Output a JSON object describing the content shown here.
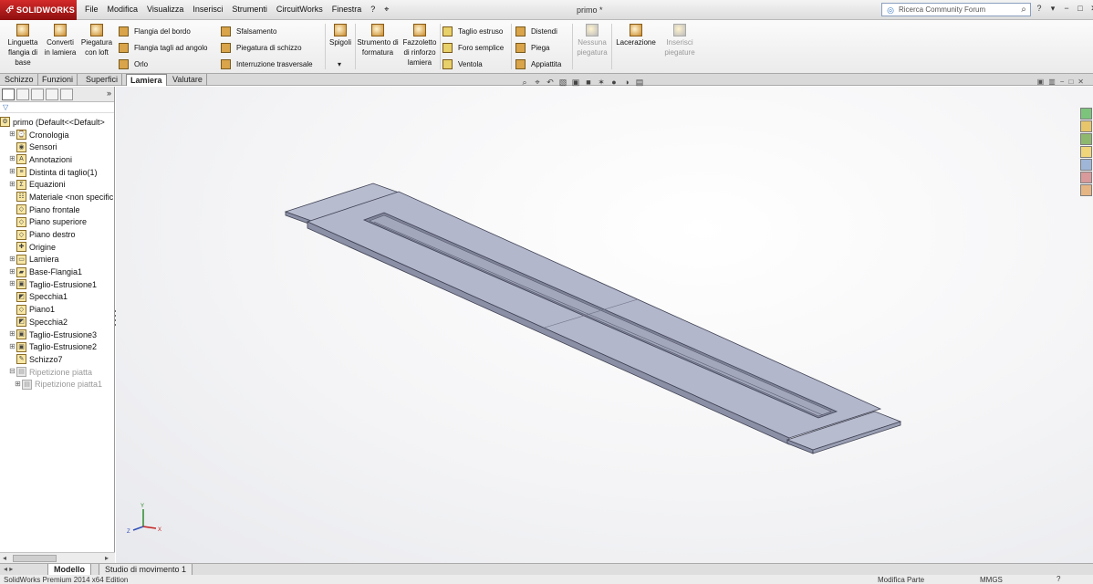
{
  "app": {
    "logo_text": "SOLIDWORKS",
    "document_title": "primo *"
  },
  "menu": [
    "File",
    "Modifica",
    "Visualizza",
    "Inserisci",
    "Strumenti",
    "CircuitWorks",
    "Finestra",
    "?"
  ],
  "search": {
    "placeholder": "Ricerca Community Forum"
  },
  "ribbon": {
    "big_buttons": [
      {
        "label": "Linguetta flangia di base",
        "icon": "base-flange-icon",
        "enabled": true
      },
      {
        "label": "Converti in lamiera",
        "icon": "convert-sheetmetal-icon",
        "enabled": true
      },
      {
        "label": "Piegatura con loft",
        "icon": "lofted-bend-icon",
        "enabled": true
      },
      {
        "label": "Spigoli",
        "icon": "corners-icon",
        "enabled": true
      },
      {
        "label": "Strumento di formatura",
        "icon": "forming-tool-icon",
        "enabled": true
      },
      {
        "label": "Fazzoletto di rinforzo lamiera",
        "icon": "gusset-icon",
        "enabled": true
      },
      {
        "label": "Nessuna piegatura",
        "icon": "no-bends-icon",
        "enabled": false
      },
      {
        "label": "Lacerazione",
        "icon": "rip-icon",
        "enabled": true
      },
      {
        "label": "Inserisci piegature",
        "icon": "insert-bends-icon",
        "enabled": false
      }
    ],
    "col1": [
      "Flangia del bordo",
      "Flangia tagli ad angolo",
      "Orlo"
    ],
    "col2": [
      "Sfalsamento",
      "Piegatura di schizzo",
      "Interruzione trasversale"
    ],
    "col3": [
      "Taglio estruso",
      "Foro semplice",
      "Ventola"
    ],
    "col4": [
      "Distendi",
      "Piega",
      "Appiattita"
    ]
  },
  "cm_tabs": [
    "Schizzo",
    "Funzioni",
    "Superfici",
    "Lamiera",
    "Valutare"
  ],
  "cm_active_tab": "Lamiera",
  "tree": [
    {
      "label": "primo  (Default<<Default>",
      "indent": 0,
      "expander": "",
      "icon": "part-icon"
    },
    {
      "label": "Cronologia",
      "indent": 1,
      "expander": "+",
      "icon": "history-icon"
    },
    {
      "label": "Sensori",
      "indent": 1,
      "expander": "",
      "icon": "sensor-icon"
    },
    {
      "label": "Annotazioni",
      "indent": 1,
      "expander": "+",
      "icon": "annotation-icon"
    },
    {
      "label": "Distinta di taglio(1)",
      "indent": 1,
      "expander": "+",
      "icon": "cutlist-icon"
    },
    {
      "label": "Equazioni",
      "indent": 1,
      "expander": "+",
      "icon": "equation-icon"
    },
    {
      "label": "Materiale <non specific",
      "indent": 1,
      "expander": "",
      "icon": "material-icon"
    },
    {
      "label": "Piano frontale",
      "indent": 1,
      "expander": "",
      "icon": "plane-icon"
    },
    {
      "label": "Piano superiore",
      "indent": 1,
      "expander": "",
      "icon": "plane-icon"
    },
    {
      "label": "Piano destro",
      "indent": 1,
      "expander": "",
      "icon": "plane-icon"
    },
    {
      "label": "Origine",
      "indent": 1,
      "expander": "",
      "icon": "origin-icon"
    },
    {
      "label": "Lamiera",
      "indent": 1,
      "expander": "+",
      "icon": "sheetmetal-icon"
    },
    {
      "label": "Base-Flangia1",
      "indent": 1,
      "expander": "+",
      "icon": "base-flange-icon"
    },
    {
      "label": "Taglio-Estrusione1",
      "indent": 1,
      "expander": "+",
      "icon": "cut-extrude-icon"
    },
    {
      "label": "Specchia1",
      "indent": 1,
      "expander": "",
      "icon": "mirror-icon"
    },
    {
      "label": "Piano1",
      "indent": 1,
      "expander": "",
      "icon": "plane-icon"
    },
    {
      "label": "Specchia2",
      "indent": 1,
      "expander": "",
      "icon": "mirror-icon"
    },
    {
      "label": "Taglio-Estrusione3",
      "indent": 1,
      "expander": "+",
      "icon": "cut-extrude-icon"
    },
    {
      "label": "Taglio-Estrusione2",
      "indent": 1,
      "expander": "+",
      "icon": "cut-extrude-icon"
    },
    {
      "label": "Schizzo7",
      "indent": 1,
      "expander": "",
      "icon": "sketch-icon"
    },
    {
      "label": "Ripetizione piatta",
      "indent": 1,
      "expander": "-",
      "icon": "flat-pattern-icon",
      "dim": true
    },
    {
      "label": "Ripetizione piatta1",
      "indent": 2,
      "expander": "+",
      "icon": "flat-pattern-icon",
      "dim": true
    }
  ],
  "bottom_tabs": [
    "Modello",
    "Studio di movimento 1"
  ],
  "bottom_active_tab": "Modello",
  "status": {
    "left": "SolidWorks Premium 2014 x64 Edition",
    "mode": "Modifica Parte",
    "units": "MMGS"
  },
  "triad": {
    "x": "X",
    "y": "Y",
    "z": "Z"
  },
  "colors": {
    "brand_red": "#c42020",
    "part_top": "#b3b7cc",
    "part_side": "#8c90a6",
    "part_edge": "#3f4253"
  }
}
